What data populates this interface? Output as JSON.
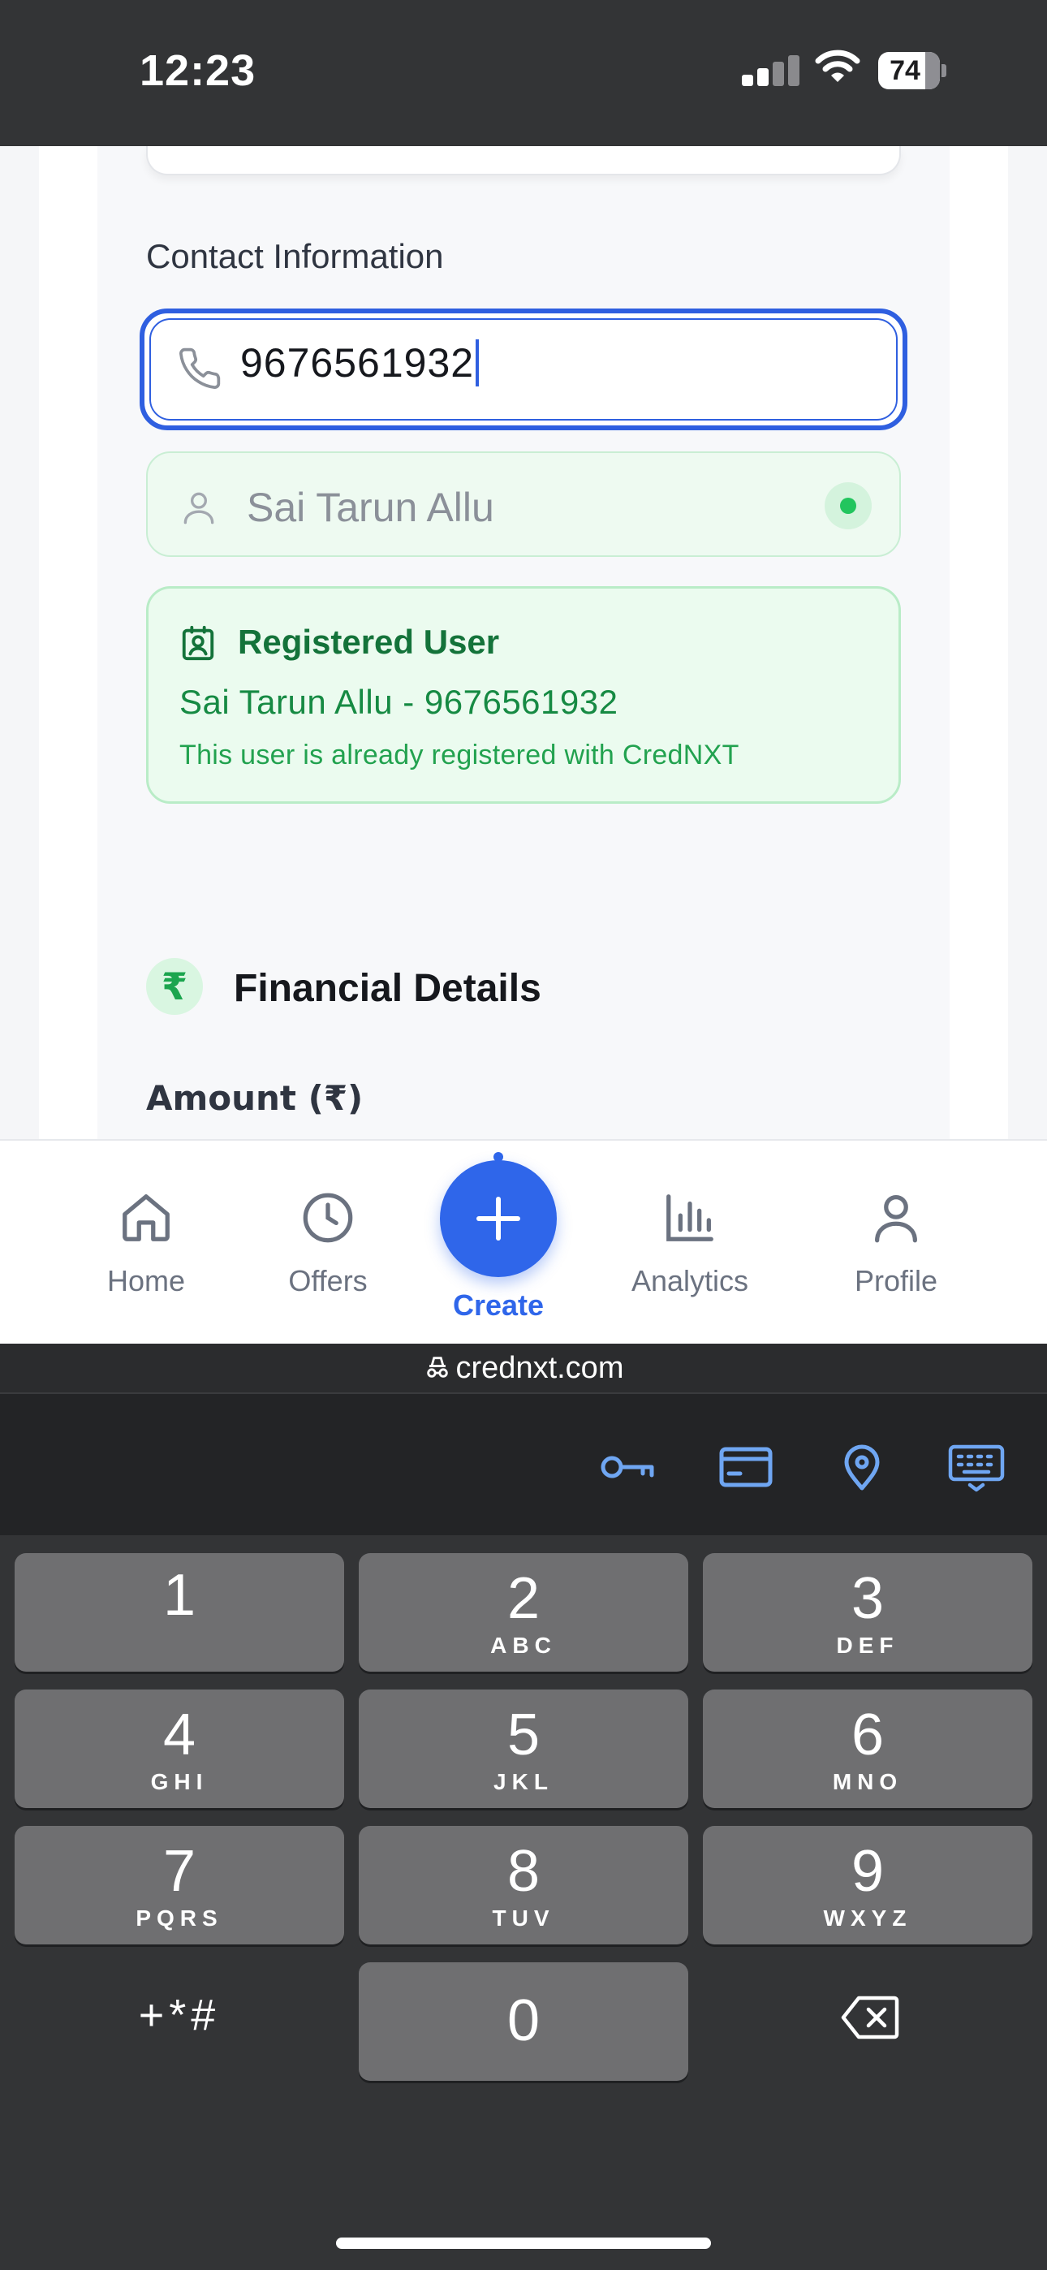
{
  "status_bar": {
    "time": "12:23",
    "battery": "74"
  },
  "form": {
    "contact_label": "Contact Information",
    "phone_value": "9676561932",
    "name_value": "Sai Tarun Allu",
    "registered": {
      "title": "Registered User",
      "line": "Sai Tarun Allu - 9676561932",
      "note": "This user is already registered with CredNXT"
    },
    "financial": {
      "icon": "₹",
      "title": "Financial Details",
      "amount_label": "Amount (₹)"
    }
  },
  "nav": {
    "home": "Home",
    "offers": "Offers",
    "create": "Create",
    "analytics": "Analytics",
    "profile": "Profile"
  },
  "browser": {
    "url": "crednxt.com"
  },
  "keypad": {
    "keys": [
      {
        "digit": "1",
        "letters": ""
      },
      {
        "digit": "2",
        "letters": "ABC"
      },
      {
        "digit": "3",
        "letters": "DEF"
      },
      {
        "digit": "4",
        "letters": "GHI"
      },
      {
        "digit": "5",
        "letters": "JKL"
      },
      {
        "digit": "6",
        "letters": "MNO"
      },
      {
        "digit": "7",
        "letters": "PQRS"
      },
      {
        "digit": "8",
        "letters": "TUV"
      },
      {
        "digit": "9",
        "letters": "WXYZ"
      },
      {
        "digit": "0",
        "letters": ""
      }
    ],
    "symbols": "+*#"
  },
  "colors": {
    "accent": "#2f66ea",
    "success": "#22c55e",
    "success_text": "#14733a"
  }
}
